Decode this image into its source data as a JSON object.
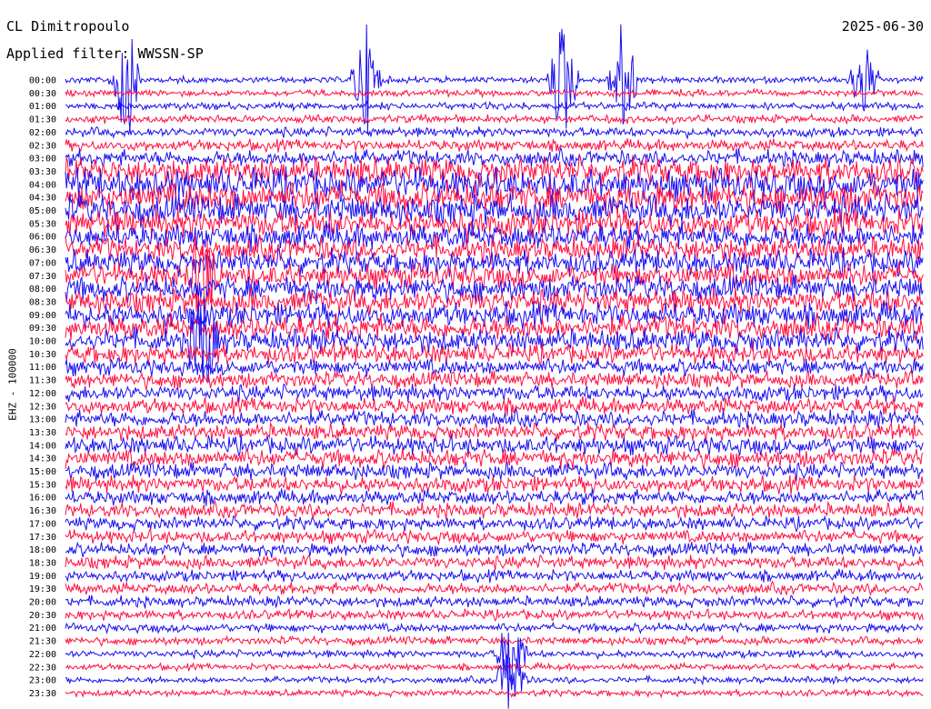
{
  "title": "CL Dimitropoulo",
  "date": "2025-06-30",
  "filter_label": "Applied filter: WWSSN-SP",
  "channel_label": "EHZ - 100000",
  "colors": {
    "blue": "#1a0ff0",
    "red": "#ff1040",
    "background": "#ffffff"
  },
  "chart_data": {
    "type": "line",
    "title": "CL Dimitropoulo",
    "ylabel": "EHZ - 100000",
    "row_labels": [
      "00:00",
      "00:30",
      "01:00",
      "01:30",
      "02:00",
      "02:30",
      "03:00",
      "03:30",
      "04:00",
      "04:30",
      "05:00",
      "05:30",
      "06:00",
      "06:30",
      "07:00",
      "07:30",
      "08:00",
      "08:30",
      "09:00",
      "09:30",
      "10:00",
      "10:30",
      "11:00",
      "11:30",
      "12:00",
      "12:30",
      "13:00",
      "13:30",
      "14:00",
      "14:30",
      "15:00",
      "15:30",
      "16:00",
      "16:30",
      "17:00",
      "17:30",
      "18:00",
      "18:30",
      "19:00",
      "19:30",
      "20:00",
      "20:30",
      "21:00",
      "21:30",
      "22:00",
      "22:30",
      "23:00",
      "23:30"
    ],
    "row_colors": [
      "blue",
      "red"
    ],
    "relative_amplitude": [
      0.15,
      0.15,
      0.18,
      0.2,
      0.25,
      0.3,
      0.45,
      0.8,
      0.9,
      0.9,
      0.85,
      0.8,
      0.75,
      0.7,
      0.7,
      0.7,
      0.7,
      0.7,
      0.7,
      0.7,
      0.65,
      0.55,
      0.45,
      0.45,
      0.45,
      0.45,
      0.45,
      0.45,
      0.5,
      0.5,
      0.45,
      0.45,
      0.4,
      0.4,
      0.35,
      0.35,
      0.35,
      0.35,
      0.3,
      0.3,
      0.28,
      0.25,
      0.22,
      0.2,
      0.18,
      0.15,
      0.15,
      0.15
    ],
    "events": [
      {
        "row": 0,
        "position": 0.35,
        "strength": 0.9
      },
      {
        "row": 0,
        "position": 0.58,
        "strength": 1.0
      },
      {
        "row": 0,
        "position": 0.65,
        "strength": 1.0
      },
      {
        "row": 0,
        "position": 0.07,
        "strength": 1.0
      },
      {
        "row": 0,
        "position": 0.93,
        "strength": 0.6
      },
      {
        "row": 15,
        "position": 0.16,
        "strength": 0.8
      },
      {
        "row": 20,
        "position": 0.16,
        "strength": 0.9
      },
      {
        "row": 44,
        "position": 0.52,
        "strength": 0.7
      },
      {
        "row": 46,
        "position": 0.52,
        "strength": 0.6
      }
    ],
    "grid": false
  }
}
